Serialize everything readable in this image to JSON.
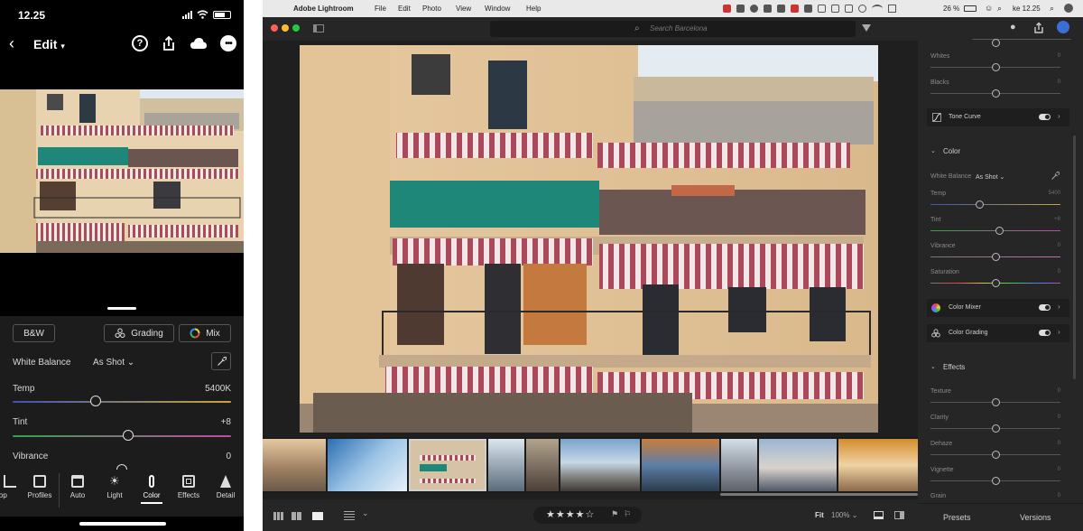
{
  "phone": {
    "status_time": "12.25",
    "header": {
      "edit_label": "Edit"
    },
    "buttons": {
      "bw": "B&W",
      "grading": "Grading",
      "mix": "Mix"
    },
    "white_balance": {
      "label": "White Balance",
      "value": "As Shot"
    },
    "sliders": [
      {
        "label": "Temp",
        "value": "5400K",
        "position": 0.38
      },
      {
        "label": "Tint",
        "value": "+8",
        "position": 0.53
      },
      {
        "label": "Vibrance",
        "value": "0",
        "position": 0.5
      }
    ],
    "nav": [
      "rop",
      "Profiles",
      "Auto",
      "Light",
      "Color",
      "Effects",
      "Detail"
    ],
    "active_nav": "Color"
  },
  "desktop": {
    "menubar": {
      "app": "Adobe Lightroom",
      "items": [
        "File",
        "Edit",
        "Photo",
        "View",
        "Window",
        "Help"
      ],
      "battery": "26 %",
      "clock": "ke 12.25"
    },
    "search_placeholder": "Search Barcelona",
    "panel": {
      "sliders_top": [
        {
          "label": "Whites",
          "value": "0",
          "position": 0.5
        },
        {
          "label": "Blacks",
          "value": "0",
          "position": 0.5
        }
      ],
      "tone_curve": "Tone Curve",
      "color_header": "Color",
      "white_balance": {
        "label": "White Balance",
        "value": "As Shot"
      },
      "color_sliders": [
        {
          "label": "Temp",
          "value": "5400",
          "position": 0.38
        },
        {
          "label": "Tint",
          "value": "+8",
          "position": 0.53
        },
        {
          "label": "Vibrance",
          "value": "0",
          "position": 0.5
        },
        {
          "label": "Saturation",
          "value": "0",
          "position": 0.5
        }
      ],
      "color_mixer": "Color Mixer",
      "color_grading": "Color Grading",
      "effects_header": "Effects",
      "effects_sliders": [
        {
          "label": "Texture",
          "value": "0",
          "position": 0.5
        },
        {
          "label": "Clarity",
          "value": "0",
          "position": 0.5
        },
        {
          "label": "Dehaze",
          "value": "0",
          "position": 0.5
        },
        {
          "label": "Vignette",
          "value": "0",
          "position": 0.5
        },
        {
          "label": "Grain",
          "value": "0",
          "position": 0.5
        }
      ]
    },
    "bottom": {
      "fit_label": "Fit",
      "zoom": "100%",
      "presets": "Presets",
      "versions": "Versions"
    }
  }
}
